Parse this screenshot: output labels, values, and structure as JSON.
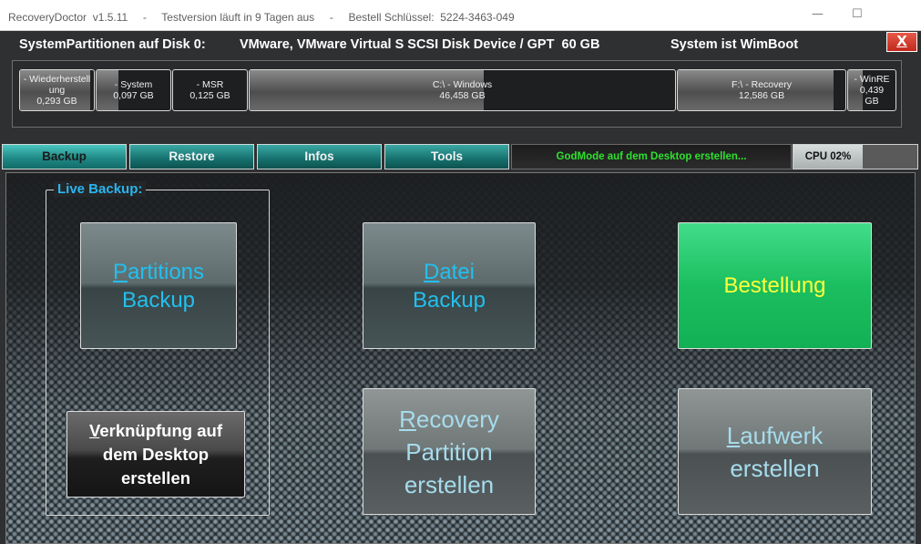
{
  "window": {
    "title": "RecoveryDoctor  v1.5.11     -     Testversion läuft in 9 Tagen aus     -     Bestell Schlüssel:  5224-3463-049",
    "minimize": "—",
    "maximize": "☐",
    "close_label": "X"
  },
  "header": {
    "prefix": "SystemPartitionen auf Disk 0:",
    "device": "VMware, VMware Virtual S SCSI Disk Device / GPT  60 GB",
    "status": "System ist WimBoot"
  },
  "partitions": [
    {
      "label": "- Wiederherstellung",
      "size": "0,293 GB",
      "fill": 0.95
    },
    {
      "label": "- System",
      "size": "0,097 GB",
      "fill": 0.3
    },
    {
      "label": "- MSR",
      "size": "0,125 GB",
      "fill": 0.0
    },
    {
      "label": "C:\\ - Windows",
      "size": "46,458 GB",
      "fill": 0.55
    },
    {
      "label": "F:\\ - Recovery",
      "size": "12,586 GB",
      "fill": 0.93
    },
    {
      "label": "- WinRE",
      "size": "0,439 GB",
      "fill": 0.3
    }
  ],
  "tabs": [
    {
      "first": "B",
      "rest": "ackup",
      "active": true
    },
    {
      "first": "R",
      "rest": "estore",
      "active": false
    },
    {
      "first": "I",
      "rest": "nfos",
      "active": false
    },
    {
      "first": "T",
      "rest": "ools",
      "active": false
    }
  ],
  "godmode": "GodMode auf dem Desktop erstellen...",
  "cpu": {
    "label": "CPU 02%",
    "value": 2
  },
  "live_backup": {
    "label": "Live Backup:"
  },
  "tiles": {
    "partitions_backup": {
      "first": "P",
      "rest": "artitions\nBackup"
    },
    "datei_backup": {
      "first": "D",
      "rest": "atei\nBackup"
    },
    "bestellung": {
      "label": "Bestellung"
    },
    "verknuepfung": {
      "first": "V",
      "rest": "erknüpfung auf\ndem Desktop\nerstellen"
    },
    "recovery_partition": {
      "first": "R",
      "rest": "ecovery\nPartition\nerstellen"
    },
    "laufwerk": {
      "first": "L",
      "rest": "aufwerk\nerstellen"
    }
  },
  "colors": {
    "teal_accent": "#1f8a86",
    "blue_text": "#22c0ee",
    "green_tile": "#1bbf5f",
    "yellow_text": "#ffff3b",
    "godmode_green": "#2fe02f",
    "close_red": "#c0281b"
  }
}
